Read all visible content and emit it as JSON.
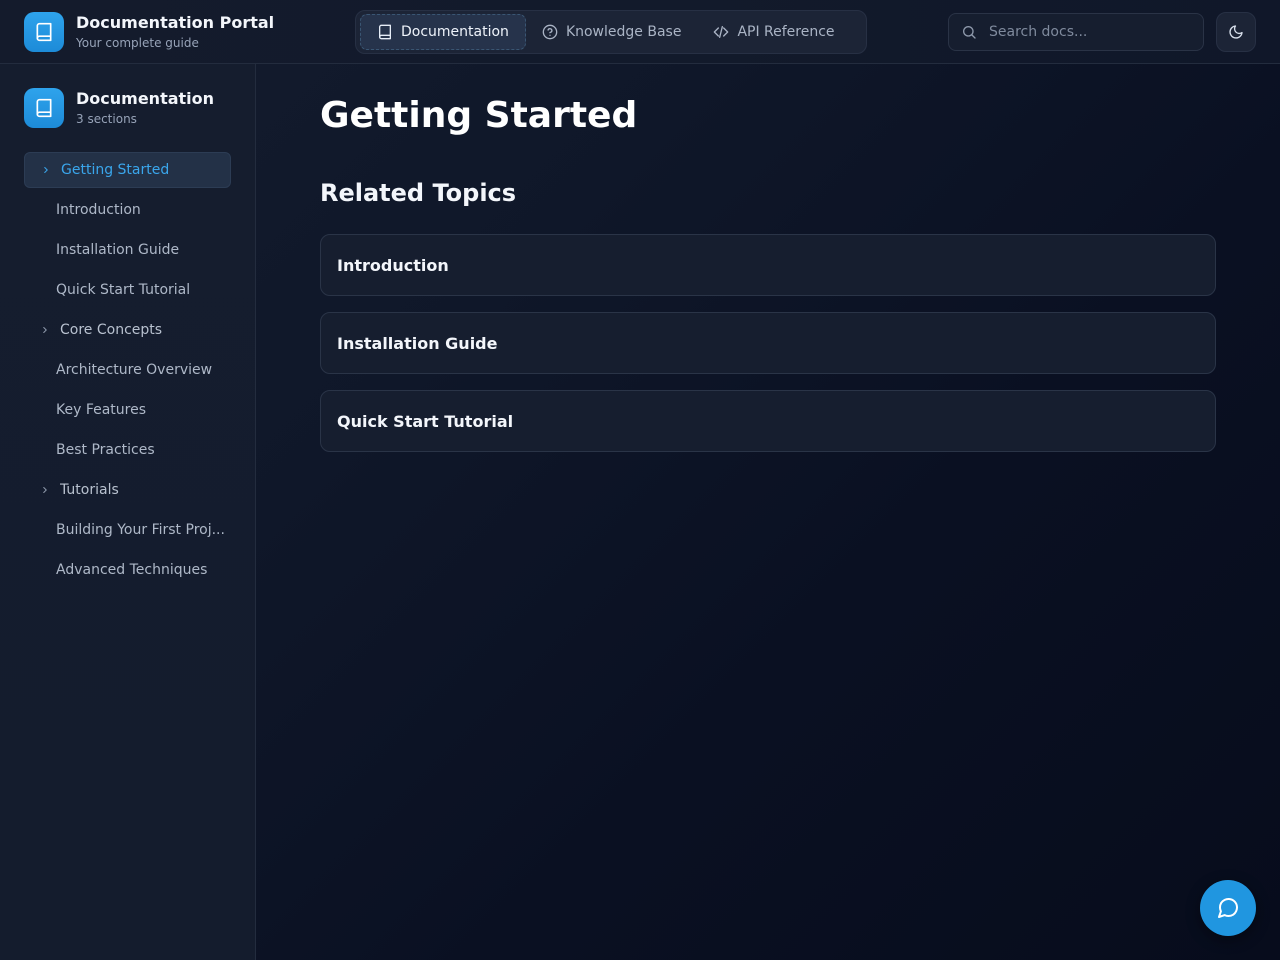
{
  "header": {
    "title": "Documentation Portal",
    "subtitle": "Your complete guide",
    "logo_icon": "book-icon",
    "tabs": [
      {
        "label": "Documentation",
        "icon": "book-icon",
        "active": true
      },
      {
        "label": "Knowledge Base",
        "icon": "help-circle-icon",
        "active": false
      },
      {
        "label": "API Reference",
        "icon": "code-icon",
        "active": false
      }
    ],
    "search": {
      "placeholder": "Search docs...",
      "value": "",
      "icon": "search-icon"
    },
    "theme_toggle_icon": "moon-icon"
  },
  "sidebar": {
    "title": "Documentation",
    "count": "3 sections",
    "items": [
      {
        "label": "Getting Started",
        "type": "section",
        "active": true
      },
      {
        "label": "Introduction",
        "type": "child"
      },
      {
        "label": "Installation Guide",
        "type": "child"
      },
      {
        "label": "Quick Start Tutorial",
        "type": "child"
      },
      {
        "label": "Core Concepts",
        "type": "section"
      },
      {
        "label": "Architecture Overview",
        "type": "child"
      },
      {
        "label": "Key Features",
        "type": "child"
      },
      {
        "label": "Best Practices",
        "type": "child"
      },
      {
        "label": "Tutorials",
        "type": "section"
      },
      {
        "label": "Building Your First Proj...",
        "type": "child"
      },
      {
        "label": "Advanced Techniques",
        "type": "child"
      }
    ]
  },
  "main": {
    "title": "Getting Started",
    "related_title": "Related Topics",
    "cards": [
      {
        "label": "Introduction"
      },
      {
        "label": "Installation Guide"
      },
      {
        "label": "Quick Start Tutorial"
      }
    ]
  },
  "chat_button_icon": "message-circle-icon",
  "colors": {
    "accent": "#2096e0",
    "active_text": "#3aa6ec",
    "background": "#0b1120"
  }
}
